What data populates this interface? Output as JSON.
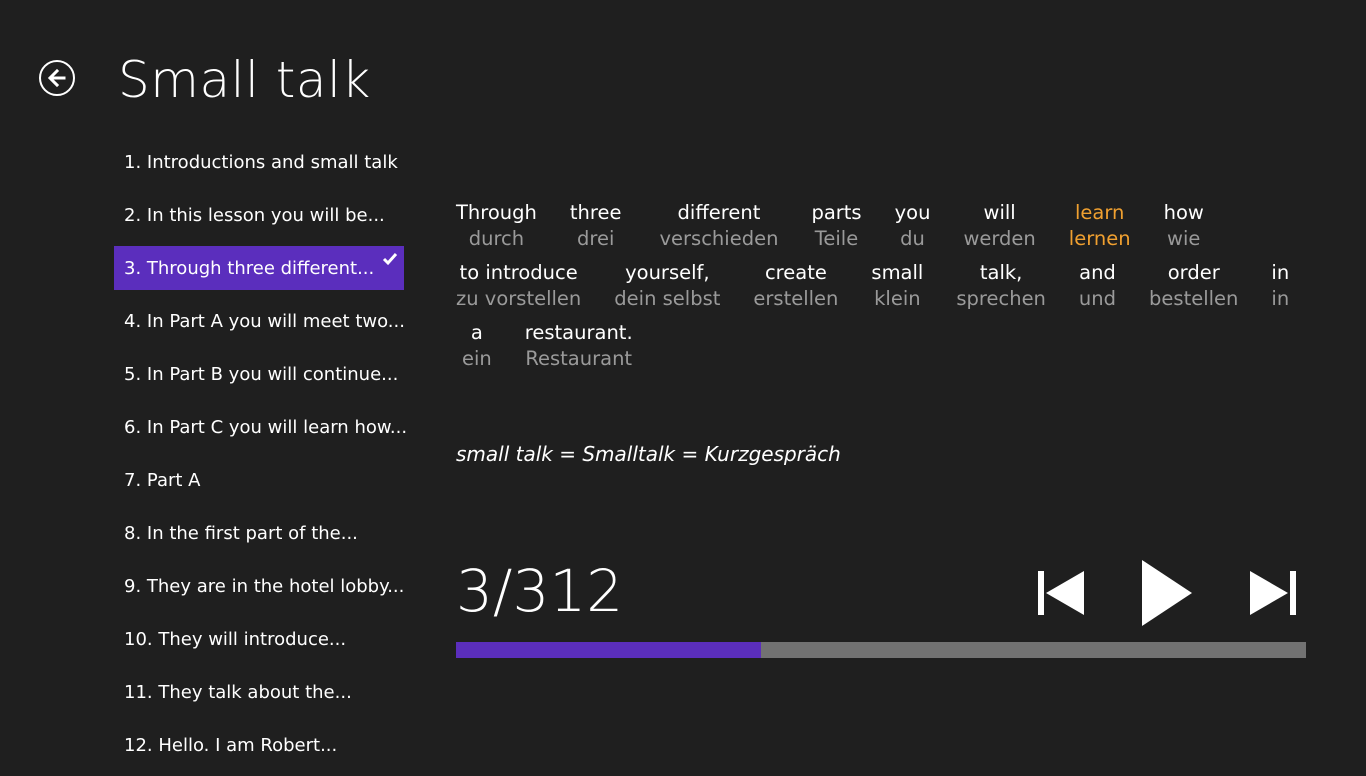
{
  "header": {
    "title": "Small talk",
    "back_icon": "back-arrow-icon"
  },
  "lessons": [
    {
      "label": "1. Introductions and small talk",
      "selected": false
    },
    {
      "label": "2. In this lesson you will be...",
      "selected": false
    },
    {
      "label": "3. Through three different...",
      "selected": true
    },
    {
      "label": "4. In Part A you will meet two...",
      "selected": false
    },
    {
      "label": "5. In Part B you will continue...",
      "selected": false
    },
    {
      "label": "6. In Part C you will learn how...",
      "selected": false
    },
    {
      "label": "7. Part A",
      "selected": false
    },
    {
      "label": "8. In the first part of the...",
      "selected": false
    },
    {
      "label": "9. They are in the hotel lobby...",
      "selected": false
    },
    {
      "label": "10. They will introduce...",
      "selected": false
    },
    {
      "label": "11. They talk about the...",
      "selected": false
    },
    {
      "label": "12. Hello. I am Robert...",
      "selected": false
    }
  ],
  "sentence": {
    "lines": [
      [
        {
          "en": "Through",
          "de": "durch",
          "highlight": false
        },
        {
          "en": "three",
          "de": "drei",
          "highlight": false
        },
        {
          "en": "different",
          "de": "verschieden",
          "highlight": false
        },
        {
          "en": "parts",
          "de": "Teile",
          "highlight": false
        },
        {
          "en": "you",
          "de": "du",
          "highlight": false
        },
        {
          "en": "will",
          "de": "werden",
          "highlight": false
        },
        {
          "en": "learn",
          "de": "lernen",
          "highlight": true
        },
        {
          "en": "how",
          "de": "wie",
          "highlight": false
        }
      ],
      [
        {
          "en": "to introduce",
          "de": "zu vorstellen",
          "highlight": false
        },
        {
          "en": "yourself,",
          "de": "dein selbst",
          "highlight": false
        },
        {
          "en": "create",
          "de": "erstellen",
          "highlight": false
        },
        {
          "en": "small",
          "de": "klein",
          "highlight": false
        },
        {
          "en": "talk,",
          "de": "sprechen",
          "highlight": false
        },
        {
          "en": "and",
          "de": "und",
          "highlight": false
        },
        {
          "en": "order",
          "de": "bestellen",
          "highlight": false
        },
        {
          "en": "in",
          "de": "in",
          "highlight": false
        }
      ],
      [
        {
          "en": "a",
          "de": "ein",
          "highlight": false
        },
        {
          "en": "restaurant.",
          "de": "Restaurant",
          "highlight": false
        }
      ]
    ]
  },
  "note": "small talk = Smalltalk = Kurzgespräch",
  "player": {
    "counter": "3/312",
    "progress": 0.359,
    "controls": [
      "previous-icon",
      "play-icon",
      "next-icon"
    ]
  },
  "colors": {
    "background": "#1f1f1f",
    "accent": "#5b2ebd",
    "highlight": "#f0a030",
    "translation": "#9a9a9a",
    "track": "#727272"
  }
}
